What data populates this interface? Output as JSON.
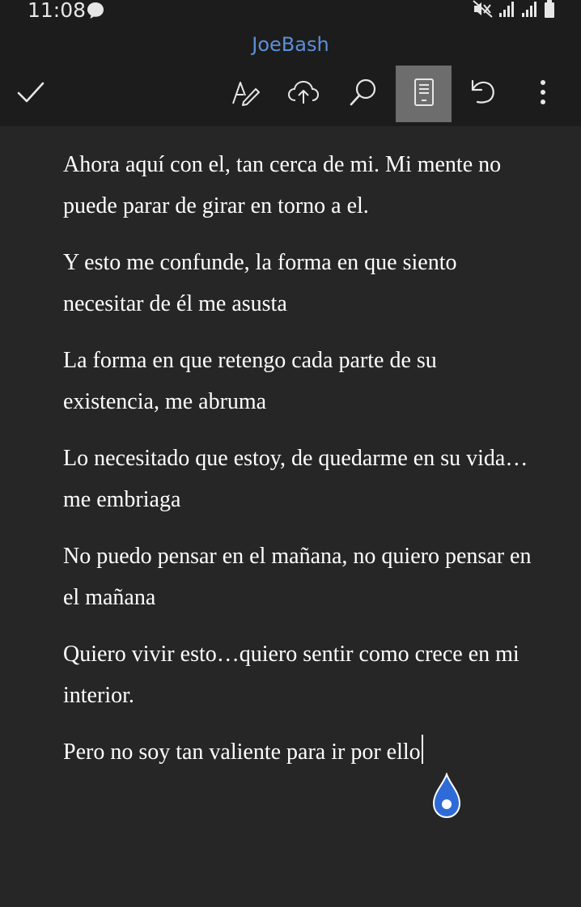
{
  "status_bar": {
    "time": "11:08",
    "icons": [
      "chat-bubble-icon",
      "mute-icon",
      "signal-icon",
      "signal-icon",
      "battery-icon"
    ]
  },
  "header": {
    "title": "JoeBash",
    "title_color": "#5b8fd8"
  },
  "toolbar": {
    "items": [
      {
        "icon": "check-icon",
        "name": "done"
      },
      {
        "icon": "pen-format-icon",
        "name": "format"
      },
      {
        "icon": "cloud-upload-icon",
        "name": "upload"
      },
      {
        "icon": "search-icon",
        "name": "search"
      },
      {
        "icon": "mobile-view-icon",
        "name": "mobile-view",
        "active": true
      },
      {
        "icon": "undo-icon",
        "name": "undo"
      },
      {
        "icon": "more-vertical-icon",
        "name": "more"
      }
    ]
  },
  "document": {
    "paragraphs": [
      "Ahora aquí con el, tan cerca de mi. Mi mente no puede parar de girar en torno a el.",
      "Y esto me confunde, la forma en que siento necesitar de él me asusta",
      "La forma en que retengo cada parte de su existencia, me abruma",
      "Lo necesitado que estoy, de quedarme en su vida…me embriaga",
      "No puedo pensar en el mañana, no quiero pensar en el mañana",
      "Quiero vivir esto…quiero sentir como crece en mi interior.",
      "Pero no soy tan valiente para ir por ello"
    ],
    "accent_color": "#2f6bd8"
  }
}
